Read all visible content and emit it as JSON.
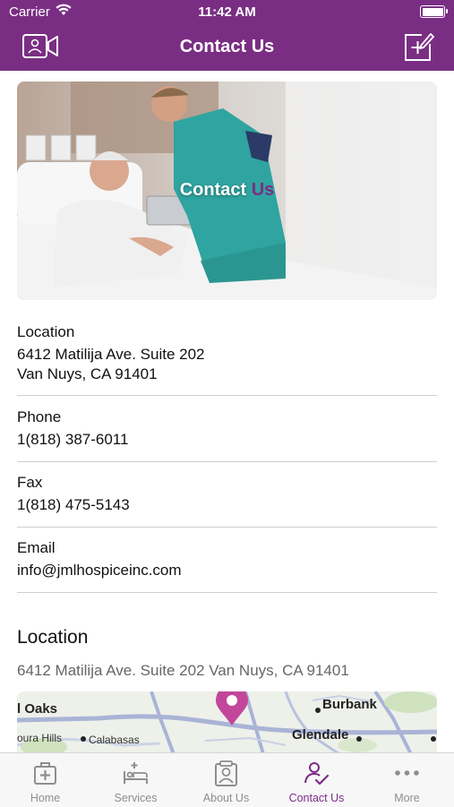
{
  "status_bar": {
    "carrier": "Carrier",
    "time": "11:42 AM"
  },
  "nav": {
    "title": "Contact Us"
  },
  "hero": {
    "title_white": "Contact",
    "title_accent": "Us"
  },
  "contact": [
    {
      "label": "Location",
      "lines": [
        "6412 Matilija Ave. Suite 202",
        "Van Nuys, CA 91401"
      ]
    },
    {
      "label": "Phone",
      "lines": [
        "1(818) 387-6011"
      ]
    },
    {
      "label": "Fax",
      "lines": [
        "1(818) 475-5143"
      ]
    },
    {
      "label": "Email",
      "lines": [
        "info@jmlhospiceinc.com"
      ]
    }
  ],
  "location_section": {
    "heading": "Location",
    "address": "6412 Matilija Ave. Suite 202 Van Nuys, CA 91401",
    "map_labels": {
      "oaks": "l Oaks",
      "burbank": "Burbank",
      "hills": "oura Hills",
      "calabasas": "Calabasas",
      "glendale": "Glendale"
    }
  },
  "tabs": [
    {
      "label": "Home",
      "icon": "home-medical-icon"
    },
    {
      "label": "Services",
      "icon": "services-bed-icon"
    },
    {
      "label": "About Us",
      "icon": "about-us-badge-icon"
    },
    {
      "label": "Contact Us",
      "icon": "contact-user-check-icon",
      "active": true
    },
    {
      "label": "More",
      "icon": "more-dots-icon"
    }
  ],
  "colors": {
    "brand_purple": "#7a2e83",
    "tab_inactive": "#8e8e8e",
    "pin": "#c2479a"
  }
}
